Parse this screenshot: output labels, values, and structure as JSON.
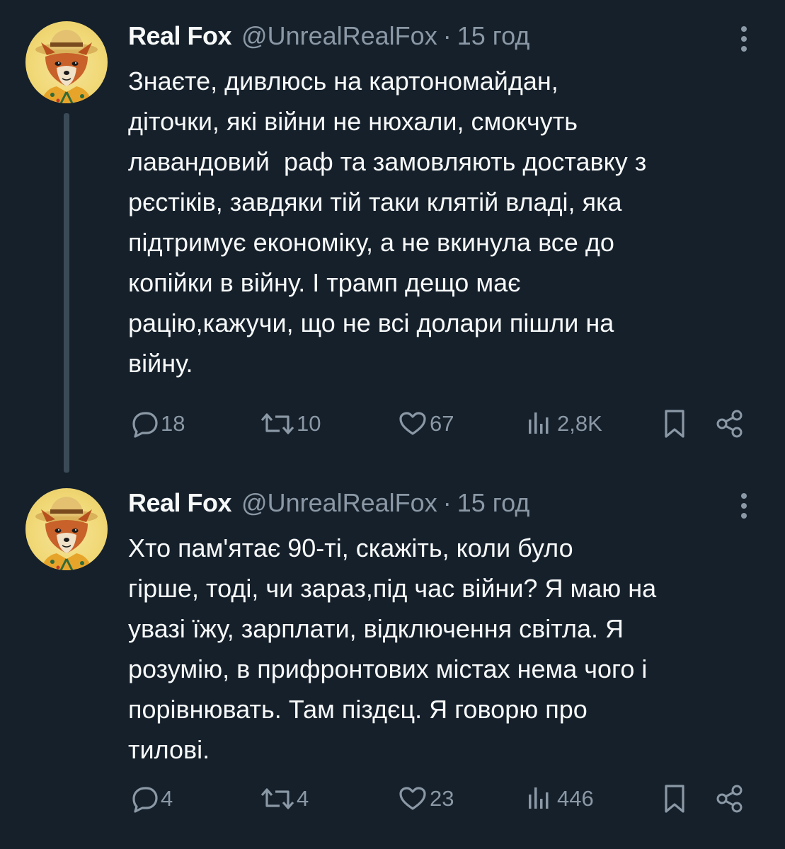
{
  "tweets": [
    {
      "display_name": "Real Fox",
      "handle": "@UnrealRealFox",
      "separator": "·",
      "time": "15 год",
      "avatar_icon": "fox-avatar",
      "text": "Знаєте, дивлюсь на картономайдан,\nдіточки, які війни не нюхали, смокчуть\nлавандовий  раф та замовляють доставку з\nрєстіків, завдяки тій таки клятій владі, яка\nпідтримує економіку, а не вкинула все до\nкопійки в війну. І трамп дещо має\nрацію,кажучи, що не всі долари пішли на\nвійну.",
      "replies": "18",
      "retweets": "10",
      "likes": "67",
      "views": "2,8K"
    },
    {
      "display_name": "Real Fox",
      "handle": "@UnrealRealFox",
      "separator": "·",
      "time": "15 год",
      "avatar_icon": "fox-avatar",
      "text": "Хто пам'ятає 90-ті, скажіть, коли було\nгірше, тоді, чи зараз,під час війни? Я маю на\nувазі їжу, зарплати, відключення світла. Я\nрозумію, в прифронтових містах нема чого і\nпорівнювать. Там піздєц. Я говорю про\nтилові.",
      "replies": "4",
      "retweets": "4",
      "likes": "23",
      "views": "446"
    }
  ],
  "icons": {
    "reply": "reply-icon",
    "retweet": "retweet-icon",
    "like": "heart-icon",
    "views": "views-icon",
    "bookmark": "bookmark-icon",
    "share": "share-icon",
    "more": "more-vertical-icon"
  },
  "colors": {
    "background": "#15202b",
    "text": "#f7f9f9",
    "secondary_text": "#8b98a5",
    "thread_line": "#3b4a57",
    "avatar_bg": "#f1d978"
  }
}
